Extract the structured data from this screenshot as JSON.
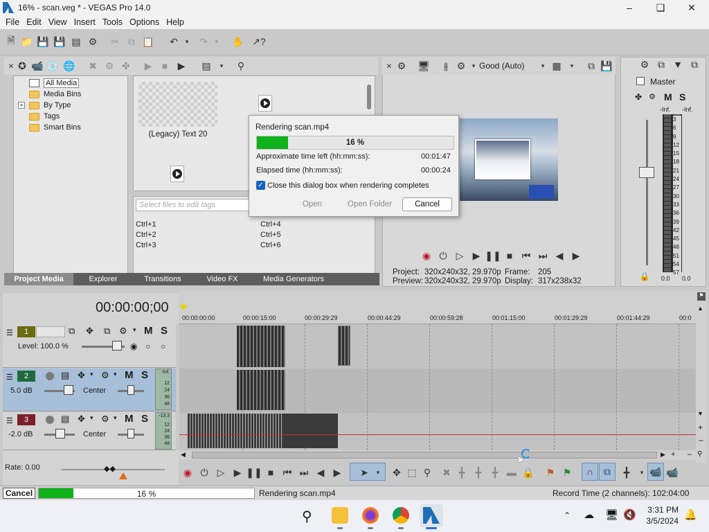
{
  "window": {
    "title": "16% - scan.veg * - VEGAS Pro 14.0"
  },
  "menu": [
    "File",
    "Edit",
    "View",
    "Insert",
    "Tools",
    "Options",
    "Help"
  ],
  "project_media": {
    "tree": [
      "All Media",
      "Media Bins",
      "By Type",
      "Tags",
      "Smart Bins"
    ],
    "tree_expand": "+",
    "media_item_label": "(Legacy) Text 20",
    "tag_placeholder": "Select files to edit tags",
    "shortcuts": [
      "Ctrl+1",
      "Ctrl+2",
      "Ctrl+3",
      "Ctrl+4",
      "Ctrl+5",
      "Ctrl+6"
    ]
  },
  "tabs": [
    "Project Media",
    "Explorer",
    "Transitions",
    "Video FX",
    "Media Generators"
  ],
  "preview": {
    "quality": "Good (Auto)",
    "project_label": "Project:",
    "project_value": "320x240x32, 29.970p",
    "frame_label": "Frame:",
    "frame_value": "205",
    "preview_label": "Preview:",
    "preview_value": "320x240x32, 29.970p",
    "display_label": "Display:",
    "display_value": "317x238x32"
  },
  "mixer": {
    "title": "Master",
    "m": "M",
    "s": "S",
    "peak_left": "-Inf.",
    "peak_right": "-Inf.",
    "scale": [
      "3",
      "6",
      "9",
      "12",
      "15",
      "18",
      "21",
      "24",
      "27",
      "30",
      "33",
      "36",
      "39",
      "42",
      "45",
      "48",
      "51",
      "54",
      "57"
    ],
    "level_left": "0.0",
    "level_right": "0.0"
  },
  "render_dialog": {
    "title": "Rendering scan.mp4",
    "progress_text": "16 %",
    "progress": 0.16,
    "time_left_label": "Approximate time left (hh:mm:ss):",
    "time_left_value": "00:01:47",
    "elapsed_label": "Elapsed time (hh:mm:ss):",
    "elapsed_value": "00:00:24",
    "close_checkbox_label": "Close this dialog box when rendering completes",
    "open_button": "Open",
    "open_folder_button": "Open Folder",
    "cancel_button": "Cancel"
  },
  "timeline": {
    "timecode": "00:00:00;00",
    "ruler_marks": [
      "00:00:00:00",
      "00:00:15:00",
      "00:00:29:29",
      "00:00:44:29",
      "00:00:59:28",
      "00:01:15:00",
      "00:01:29:29",
      "00:01:44:29",
      "00:0"
    ],
    "tracks": [
      {
        "num": "1",
        "level_label": "Level: 100.0 %",
        "m": "M",
        "s": "S"
      },
      {
        "num": "2",
        "db": "5.0 dB",
        "pan": "Center",
        "m": "M",
        "s": "S",
        "meter_top": "-Inf.",
        "meter_vals": [
          "12",
          "24",
          "36",
          "48"
        ]
      },
      {
        "num": "3",
        "db": "-2.0 dB",
        "pan": "Center",
        "m": "M",
        "s": "S",
        "meter_top": "-13.3",
        "meter_vals": [
          "12",
          "24",
          "36",
          "48"
        ]
      }
    ],
    "rate": "Rate: 0.00"
  },
  "status": {
    "cancel": "Cancel",
    "progress_text": "16 %",
    "progress": 0.16,
    "rendering": "Rendering scan.mp4",
    "record_time": "Record Time (2 channels): 102:04:00"
  },
  "taskbar": {
    "time": "3:31 PM",
    "date": "3/5/2024"
  },
  "colors": {
    "progress": "#0fb21a",
    "track1": "#6b6b10",
    "track2": "#1f6b3e",
    "track3": "#7a1f2a",
    "selected_track": "#a7bfd8"
  }
}
